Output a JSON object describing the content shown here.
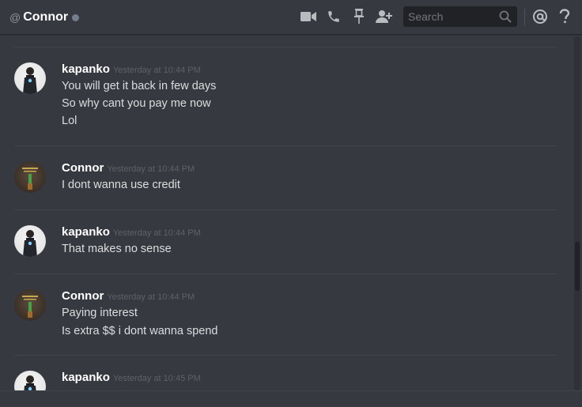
{
  "header": {
    "at_symbol": "@",
    "channel_name": "Connor",
    "status": "offline",
    "search_placeholder": "Search",
    "icons": [
      "video-call-icon",
      "voice-call-icon",
      "pin-icon",
      "add-friend-icon",
      "search-icon",
      "mention-icon",
      "help-icon"
    ]
  },
  "messages": [
    {
      "author": "kapanko",
      "timestamp": "Yesterday at 10:44 PM",
      "lines": [
        "You will get it back in few days",
        "So why cant you pay me now",
        "Lol"
      ]
    },
    {
      "author": "Connor",
      "timestamp": "Yesterday at 10:44 PM",
      "lines": [
        "I dont wanna use credit"
      ]
    },
    {
      "author": "kapanko",
      "timestamp": "Yesterday at 10:44 PM",
      "lines": [
        "That makes no sense"
      ]
    },
    {
      "author": "Connor",
      "timestamp": "Yesterday at 10:44 PM",
      "lines": [
        "Paying interest",
        "Is extra $$ i dont wanna spend"
      ]
    },
    {
      "author": "kapanko",
      "timestamp": "Yesterday at 10:45 PM",
      "lines": []
    }
  ],
  "colors": {
    "background": "#36393f",
    "header_text": "#ffffff",
    "body_text": "#dcddde",
    "timestamp": "#5d6269",
    "status_offline": "#747f8d"
  }
}
